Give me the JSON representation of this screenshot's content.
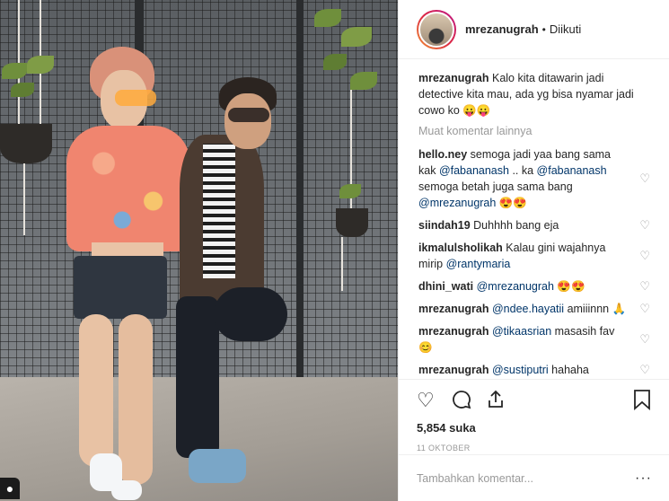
{
  "post": {
    "username": "mrezanugrah",
    "follow_state": "Diikuti",
    "caption_user": "mrezanugrah",
    "caption_text": "Kalo kita ditawarin jadi detective kita mau, ada yg bisa nyamar jadi cowo ko 😛😛",
    "load_more": "Muat komentar lainnya",
    "likes": "5,854 suka",
    "date": "11 OKTOBER",
    "add_comment_placeholder": "Tambahkan komentar...",
    "more_options": "···"
  },
  "comments": [
    {
      "user": "hello.ney",
      "text": " semoga jadi yaa bang sama kak ",
      "m1": "@fabananash",
      "t2": " .. ka ",
      "m2": "@fabananash",
      "t3": " semoga betah juga sama bang ",
      "m3": "@mrezanugrah",
      "t4": " 😍😍"
    },
    {
      "user": "siindah19",
      "text": " Duhhhh bang eja"
    },
    {
      "user": "ikmalulsholikah",
      "text": " Kalau gini wajahnya mirip ",
      "m1": "@rantymaria"
    },
    {
      "user": "dhini_wati",
      "text": " ",
      "m1": "@mrezanugrah",
      "t2": " 😍😍"
    },
    {
      "user": "mrezanugrah",
      "text": " ",
      "m1": "@ndee.hayatii",
      "t2": " amiiinnn 🙏"
    },
    {
      "user": "mrezanugrah",
      "text": " ",
      "m1": "@tikaasrian",
      "t2": " masasih fav 😊"
    },
    {
      "user": "mrezanugrah",
      "text": " ",
      "m1": "@sustiputri",
      "t2": " hahaha"
    }
  ],
  "icons": {
    "like": "heart-icon",
    "comment": "comment-icon",
    "share": "share-icon",
    "save": "bookmark-icon",
    "comment_like": "heart-icon"
  },
  "colors": {
    "mention": "#003569",
    "muted": "#999999",
    "text": "#262626"
  }
}
